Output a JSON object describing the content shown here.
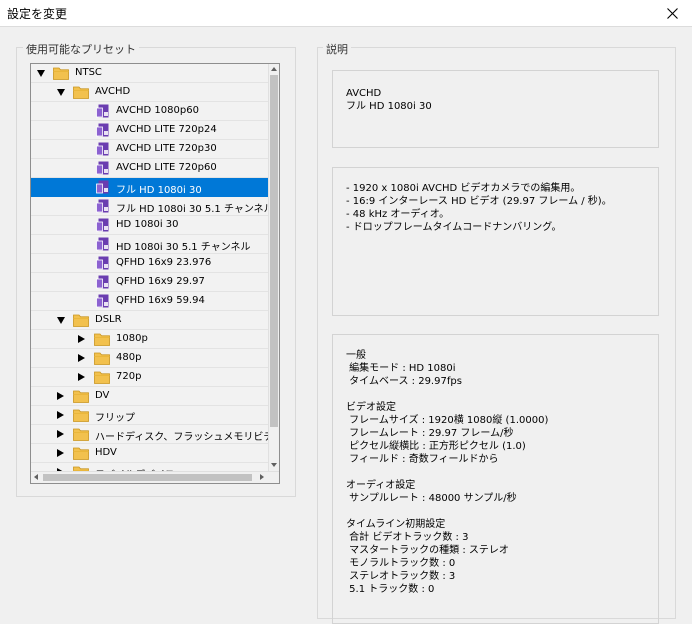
{
  "window": {
    "title": "設定を変更"
  },
  "presets_group": {
    "title": "使用可能なプリセット"
  },
  "description_group": {
    "title": "説明"
  },
  "tree": [
    {
      "label": "NTSC",
      "level": 0,
      "type": "folder",
      "toggle": "open",
      "selected": false
    },
    {
      "label": "AVCHD",
      "level": 1,
      "type": "folder",
      "toggle": "open",
      "selected": false
    },
    {
      "label": "AVCHD 1080p60",
      "level": 2,
      "type": "preset",
      "toggle": "none",
      "selected": false
    },
    {
      "label": "AVCHD LITE 720p24",
      "level": 2,
      "type": "preset",
      "toggle": "none",
      "selected": false
    },
    {
      "label": "AVCHD LITE 720p30",
      "level": 2,
      "type": "preset",
      "toggle": "none",
      "selected": false
    },
    {
      "label": "AVCHD LITE 720p60",
      "level": 2,
      "type": "preset",
      "toggle": "none",
      "selected": false
    },
    {
      "label": "フル HD 1080i 30",
      "level": 2,
      "type": "preset",
      "toggle": "none",
      "selected": true
    },
    {
      "label": "フル HD 1080i 30 5.1 チャンネル",
      "level": 2,
      "type": "preset",
      "toggle": "none",
      "selected": false
    },
    {
      "label": "HD 1080i 30",
      "level": 2,
      "type": "preset",
      "toggle": "none",
      "selected": false
    },
    {
      "label": "HD 1080i 30 5.1 チャンネル",
      "level": 2,
      "type": "preset",
      "toggle": "none",
      "selected": false
    },
    {
      "label": "QFHD 16x9 23.976",
      "level": 2,
      "type": "preset",
      "toggle": "none",
      "selected": false
    },
    {
      "label": "QFHD 16x9 29.97",
      "level": 2,
      "type": "preset",
      "toggle": "none",
      "selected": false
    },
    {
      "label": "QFHD 16x9 59.94",
      "level": 2,
      "type": "preset",
      "toggle": "none",
      "selected": false
    },
    {
      "label": "DSLR",
      "level": 1,
      "type": "folder",
      "toggle": "open",
      "selected": false
    },
    {
      "label": "1080p",
      "level": 2,
      "type": "folder",
      "toggle": "closed",
      "selected": false
    },
    {
      "label": "480p",
      "level": 2,
      "type": "folder",
      "toggle": "closed",
      "selected": false
    },
    {
      "label": "720p",
      "level": 2,
      "type": "folder",
      "toggle": "closed",
      "selected": false
    },
    {
      "label": "DV",
      "level": 1,
      "type": "folder",
      "toggle": "closed",
      "selected": false
    },
    {
      "label": "フリップ",
      "level": 1,
      "type": "folder",
      "toggle": "closed",
      "selected": false
    },
    {
      "label": "ハードディスク、フラッシュメモリビデオカ",
      "level": 1,
      "type": "folder",
      "toggle": "closed",
      "selected": false
    },
    {
      "label": "HDV",
      "level": 1,
      "type": "folder",
      "toggle": "closed",
      "selected": false
    },
    {
      "label": "モバイルデバイス",
      "level": 1,
      "type": "folder",
      "toggle": "closed",
      "selected": false
    }
  ],
  "description": {
    "summary": "AVCHD\nフル HD 1080i 30",
    "details": "- 1920 x 1080i AVCHD ビデオカメラでの編集用。\n- 16:9 インターレース HD ビデオ (29.97 フレーム / 秒)。\n- 48 kHz オーディオ。\n- ドロップフレームタイムコードナンバリング。",
    "settings": "一般\n 編集モード : HD 1080i\n タイムベース : 29.97fps\n\nビデオ設定\n フレームサイズ : 1920横 1080縦 (1.0000)\n フレームレート : 29.97 フレーム/秒\n ピクセル縦横比 : 正方形ピクセル (1.0)\n フィールド : 奇数フィールドから\n\nオーディオ設定\n サンプルレート : 48000 サンプル/秒\n\nタイムライン初期設定\n 合計 ビデオトラック数 : 3\n マスタートラックの種類 : ステレオ\n モノラルトラック数 : 0\n ステレオトラック数 : 3\n 5.1 トラック数 : 0"
  },
  "colors": {
    "selection": "#0078d7",
    "folder": "#f2c14e",
    "preset": "#6a3db0"
  }
}
